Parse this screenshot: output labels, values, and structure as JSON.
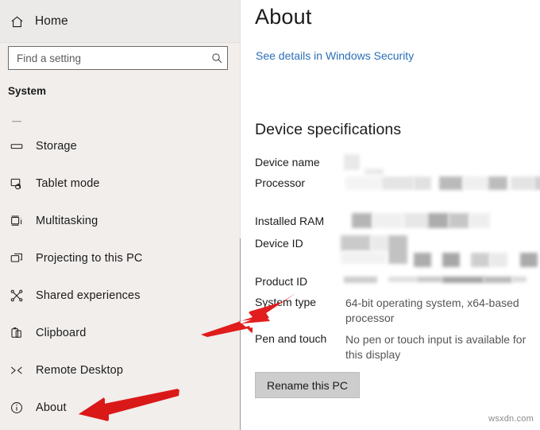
{
  "sidebar": {
    "home_label": "Home",
    "search": {
      "placeholder": "Find a setting",
      "value": ""
    },
    "section_title": "System",
    "items": [
      {
        "label": "",
        "icon": "partial-item-icon",
        "clipped": true
      },
      {
        "label": "Storage",
        "icon": "storage-icon"
      },
      {
        "label": "Tablet mode",
        "icon": "tablet-mode-icon"
      },
      {
        "label": "Multitasking",
        "icon": "multitasking-icon"
      },
      {
        "label": "Projecting to this PC",
        "icon": "projecting-icon"
      },
      {
        "label": "Shared experiences",
        "icon": "shared-experiences-icon"
      },
      {
        "label": "Clipboard",
        "icon": "clipboard-icon"
      },
      {
        "label": "Remote Desktop",
        "icon": "remote-desktop-icon"
      },
      {
        "label": "About",
        "icon": "about-info-icon"
      }
    ]
  },
  "main": {
    "page_title": "About",
    "security_link": "See details in Windows Security",
    "spec_heading": "Device specifications",
    "specs": [
      {
        "label": "Device name",
        "value": "",
        "redacted": true
      },
      {
        "label": "Processor",
        "value": "",
        "redacted": true
      },
      {
        "label": "Installed RAM",
        "value": "",
        "redacted": true
      },
      {
        "label": "Device ID",
        "value": "",
        "redacted": true
      },
      {
        "label": "Product ID",
        "value": "",
        "redacted": true
      },
      {
        "label": "System type",
        "value": "64-bit operating system, x64-based processor",
        "redacted": false
      },
      {
        "label": "Pen and touch",
        "value": "No pen or touch input is available for this display",
        "redacted": false
      }
    ],
    "rename_button": "Rename this PC"
  },
  "annotations": {
    "arrow_color": "#e01b1b",
    "arrow_system_type": "arrow pointing up-right at System type",
    "arrow_about": "arrow pointing left at About"
  },
  "watermark": "wsxdn.com",
  "colors": {
    "sidebar_bg": "#f1eeec",
    "link": "#2a6fb8",
    "button_bg": "#cdcdcd",
    "text": "#1b1b1b",
    "value_text": "#555555"
  }
}
